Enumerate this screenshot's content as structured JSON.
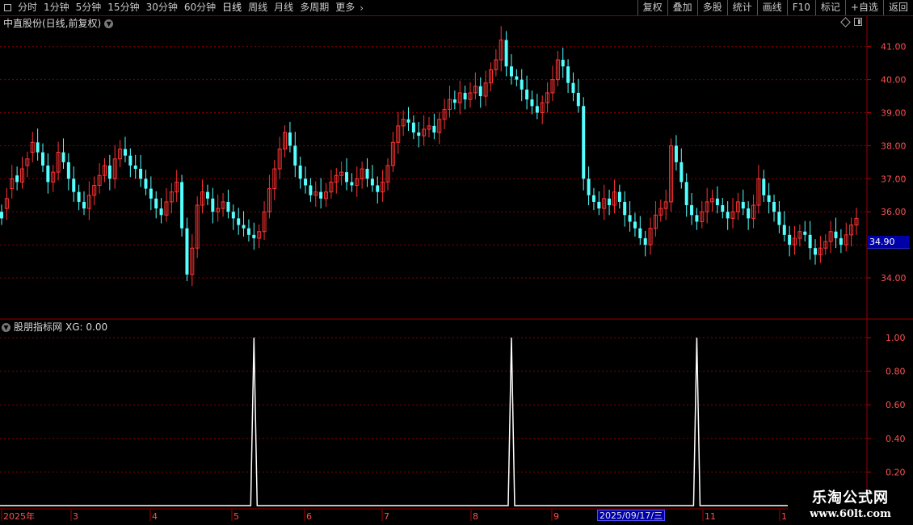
{
  "toolbar": {
    "left_items": [
      "分时",
      "1分钟",
      "5分钟",
      "15分钟",
      "30分钟",
      "60分钟",
      "日线",
      "周线",
      "月线",
      "多周期",
      "更多"
    ],
    "active": "日线",
    "right_items": [
      "复权",
      "叠加",
      "多股",
      "统计",
      "画线",
      "F10",
      "标记",
      "+自选",
      "返回"
    ]
  },
  "stock": {
    "title": "中直股份(日线,前复权)",
    "last_price_tag": "34.90"
  },
  "indicator": {
    "title": "股朋指标网",
    "value_label": "XG: 0.00"
  },
  "date_axis": {
    "labels": [
      "2025年",
      "3",
      "4",
      "5",
      "6",
      "7",
      "8",
      "9",
      "2025/09/17/三",
      "11",
      "12"
    ],
    "highlight": "2025/09/17/三"
  },
  "watermark": {
    "line1": "乐淘公式网",
    "line2": "www.60lt.com"
  },
  "colors": {
    "up": "#ff3232",
    "down": "#54ffff",
    "grid": "#8a0000",
    "axis_text": "#ff5a5a",
    "signal": "#ffffff"
  },
  "chart_data": [
    {
      "type": "candlestick",
      "title": "中直股份(日线,前复权)",
      "ylim": [
        33,
        42.3
      ],
      "y_ticks": [
        34.0,
        35.0,
        36.0,
        37.0,
        38.0,
        39.0,
        40.0,
        41.0
      ],
      "y_tick_labels": [
        "34.00",
        "35.00",
        "36.00",
        "37.00",
        "38.00",
        "39.00",
        "40.00",
        "41.00"
      ],
      "grid": true,
      "last_price": 34.9,
      "month_labels": [
        "2025年",
        "3",
        "4",
        "5",
        "6",
        "7",
        "8",
        "9",
        "2025/09/17/三",
        "11",
        "12"
      ],
      "close": [
        35.8,
        36.4,
        37.0,
        36.9,
        37.3,
        37.6,
        38.1,
        37.8,
        37.4,
        36.9,
        37.2,
        37.8,
        37.5,
        37.0,
        36.6,
        36.3,
        36.1,
        36.5,
        36.8,
        37.1,
        37.4,
        37.0,
        37.6,
        37.9,
        37.7,
        37.4,
        37.3,
        37.0,
        36.7,
        36.4,
        36.1,
        35.9,
        36.3,
        36.6,
        36.9,
        35.5,
        34.1,
        34.9,
        36.2,
        36.6,
        36.4,
        36.0,
        36.1,
        36.3,
        36.0,
        35.8,
        35.6,
        35.5,
        35.3,
        35.2,
        35.4,
        36.0,
        36.7,
        37.3,
        37.9,
        38.4,
        38.0,
        37.4,
        37.0,
        36.8,
        36.5,
        36.6,
        36.4,
        36.6,
        36.9,
        37.1,
        37.2,
        36.9,
        36.8,
        37.0,
        37.3,
        37.0,
        36.8,
        36.6,
        36.9,
        37.4,
        38.1,
        38.6,
        38.8,
        38.7,
        38.4,
        38.3,
        38.5,
        38.6,
        38.4,
        38.8,
        39.1,
        39.4,
        39.3,
        39.6,
        39.4,
        39.6,
        39.8,
        39.5,
        39.9,
        40.3,
        40.6,
        41.2,
        40.4,
        40.1,
        40.0,
        39.7,
        39.4,
        39.2,
        39.0,
        39.3,
        39.6,
        40.0,
        40.6,
        40.4,
        39.9,
        39.6,
        39.2,
        37.0,
        36.5,
        36.3,
        36.1,
        36.4,
        36.2,
        36.6,
        36.3,
        35.9,
        35.7,
        35.5,
        35.2,
        35.0,
        35.5,
        35.9,
        36.1,
        36.3,
        38.0,
        37.5,
        36.9,
        36.2,
        35.9,
        35.7,
        36.0,
        36.3,
        36.4,
        36.2,
        36.0,
        35.8,
        36.0,
        36.3,
        36.1,
        35.8,
        36.2,
        37.0,
        36.5,
        36.3,
        36.0,
        35.6,
        35.3,
        35.0,
        35.2,
        35.4,
        35.3,
        34.9,
        34.7,
        34.9,
        35.1,
        35.4,
        35.2,
        35.0,
        35.3,
        35.6,
        35.8
      ],
      "open": [
        36.0,
        36.1,
        36.7,
        37.1,
        36.9,
        37.4,
        37.8,
        38.1,
        37.8,
        37.4,
        36.9,
        37.2,
        37.8,
        37.5,
        37.0,
        36.6,
        36.3,
        36.1,
        36.5,
        36.8,
        37.1,
        37.4,
        37.0,
        37.6,
        37.9,
        37.7,
        37.4,
        37.3,
        37.0,
        36.7,
        36.4,
        36.1,
        35.9,
        36.3,
        36.6,
        36.9,
        35.5,
        34.1,
        34.9,
        36.2,
        36.6,
        36.4,
        36.0,
        36.1,
        36.3,
        36.0,
        35.8,
        35.6,
        35.5,
        35.3,
        35.2,
        35.4,
        36.0,
        36.7,
        37.3,
        37.9,
        38.4,
        38.0,
        37.4,
        37.0,
        36.8,
        36.5,
        36.6,
        36.4,
        36.6,
        36.9,
        37.1,
        37.2,
        36.9,
        36.8,
        37.0,
        37.3,
        37.0,
        36.8,
        36.6,
        36.9,
        37.4,
        38.1,
        38.6,
        38.8,
        38.7,
        38.4,
        38.3,
        38.5,
        38.6,
        38.4,
        38.8,
        39.1,
        39.4,
        39.3,
        39.6,
        39.4,
        39.6,
        39.8,
        39.5,
        39.9,
        40.3,
        40.6,
        41.2,
        40.4,
        40.1,
        40.0,
        39.7,
        39.4,
        39.2,
        39.0,
        39.3,
        39.6,
        40.0,
        40.6,
        40.4,
        39.9,
        39.6,
        39.2,
        37.0,
        36.5,
        36.3,
        36.1,
        36.4,
        36.2,
        36.6,
        36.3,
        35.9,
        35.7,
        35.5,
        35.2,
        35.0,
        35.5,
        35.9,
        36.1,
        36.3,
        38.0,
        37.5,
        36.9,
        36.2,
        35.9,
        35.7,
        36.0,
        36.3,
        36.4,
        36.2,
        36.0,
        35.8,
        36.0,
        36.3,
        36.1,
        35.8,
        36.2,
        37.0,
        36.5,
        36.3,
        36.0,
        35.6,
        35.3,
        35.0,
        35.2,
        35.4,
        35.3,
        34.9,
        34.7,
        34.9,
        35.1,
        35.4,
        35.2,
        35.0,
        35.3,
        35.6
      ]
    },
    {
      "type": "line",
      "title": "股朋指标网",
      "series": [
        {
          "name": "XG",
          "last_value": 0.0
        }
      ],
      "ylim": [
        0,
        1.08
      ],
      "y_ticks": [
        0.2,
        0.4,
        0.6,
        0.8,
        1.0
      ],
      "y_tick_labels": [
        "0.20",
        "0.40",
        "0.60",
        "0.80",
        "1.00"
      ],
      "signal_indices": [
        49,
        99,
        135
      ],
      "grid": true
    }
  ]
}
